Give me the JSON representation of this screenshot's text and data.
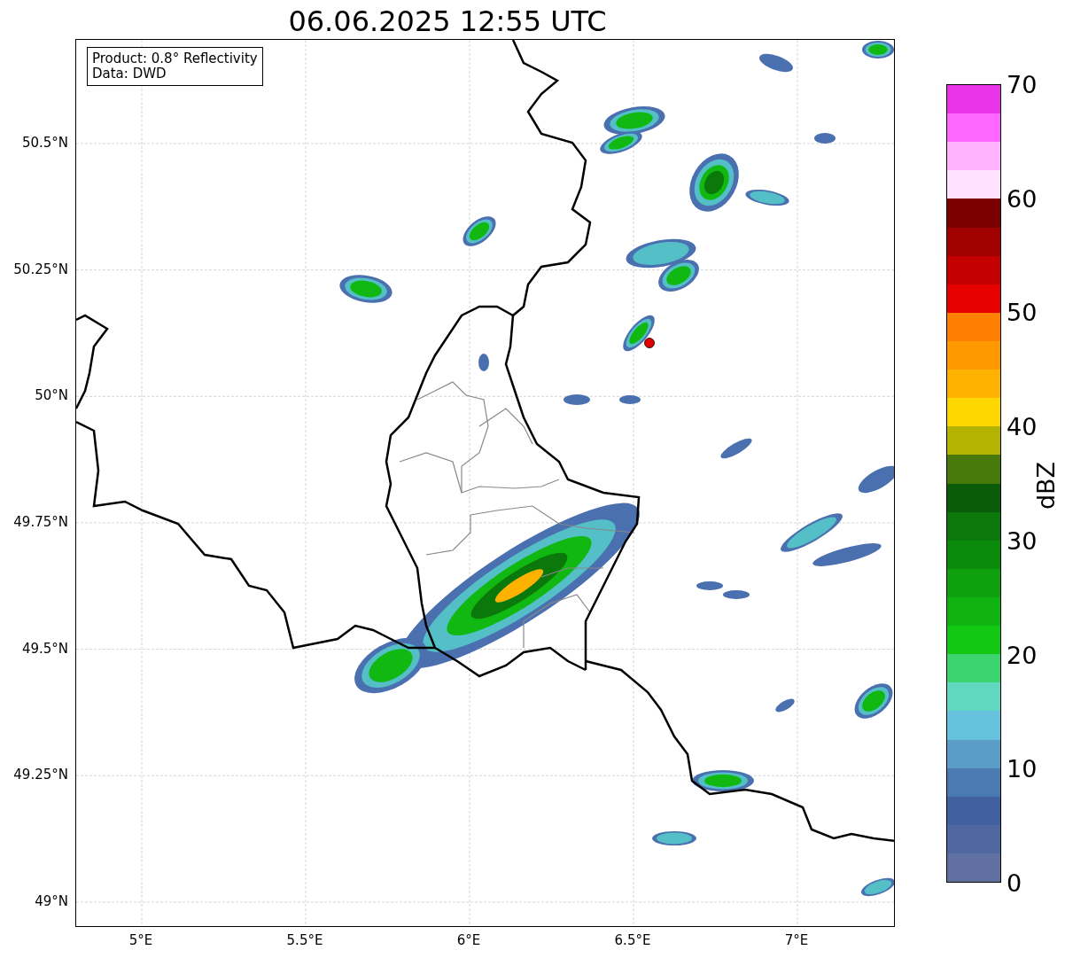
{
  "title": "06.06.2025 12:55 UTC",
  "info_box": [
    "Product: 0.8° Reflectivity",
    "Data: DWD"
  ],
  "x_ticks": [
    "5°E",
    "5.5°E",
    "6°E",
    "6.5°E",
    "7°E"
  ],
  "y_ticks": [
    "50.5°N",
    "50.25°N",
    "50°N",
    "49.75°N",
    "49.5°N",
    "49.25°N",
    "49°N"
  ],
  "colorbar": {
    "label": "dBZ",
    "ticks": [
      "70",
      "60",
      "50",
      "40",
      "30",
      "20",
      "10",
      "0"
    ],
    "segments": [
      {
        "color": "#e833e8"
      },
      {
        "color": "#ff66ff"
      },
      {
        "color": "#ffb3ff"
      },
      {
        "color": "#ffe0ff"
      },
      {
        "color": "#7a0000"
      },
      {
        "color": "#a00000"
      },
      {
        "color": "#c40000"
      },
      {
        "color": "#e60000"
      },
      {
        "color": "#ff7f00"
      },
      {
        "color": "#ff9900"
      },
      {
        "color": "#ffb300"
      },
      {
        "color": "#ffd700"
      },
      {
        "color": "#b3b300"
      },
      {
        "color": "#477a0a"
      },
      {
        "color": "#0a5c0a"
      },
      {
        "color": "#0a780a"
      },
      {
        "color": "#0a8c0a"
      },
      {
        "color": "#0fa00f"
      },
      {
        "color": "#10b410"
      },
      {
        "color": "#12c812"
      },
      {
        "color": "#3cd46e"
      },
      {
        "color": "#60d8c0"
      },
      {
        "color": "#66c2dd"
      },
      {
        "color": "#5a9ec8"
      },
      {
        "color": "#4a7ab0"
      },
      {
        "color": "#4060a0"
      },
      {
        "color": "#5068a0"
      },
      {
        "color": "#6070a0"
      }
    ]
  }
}
